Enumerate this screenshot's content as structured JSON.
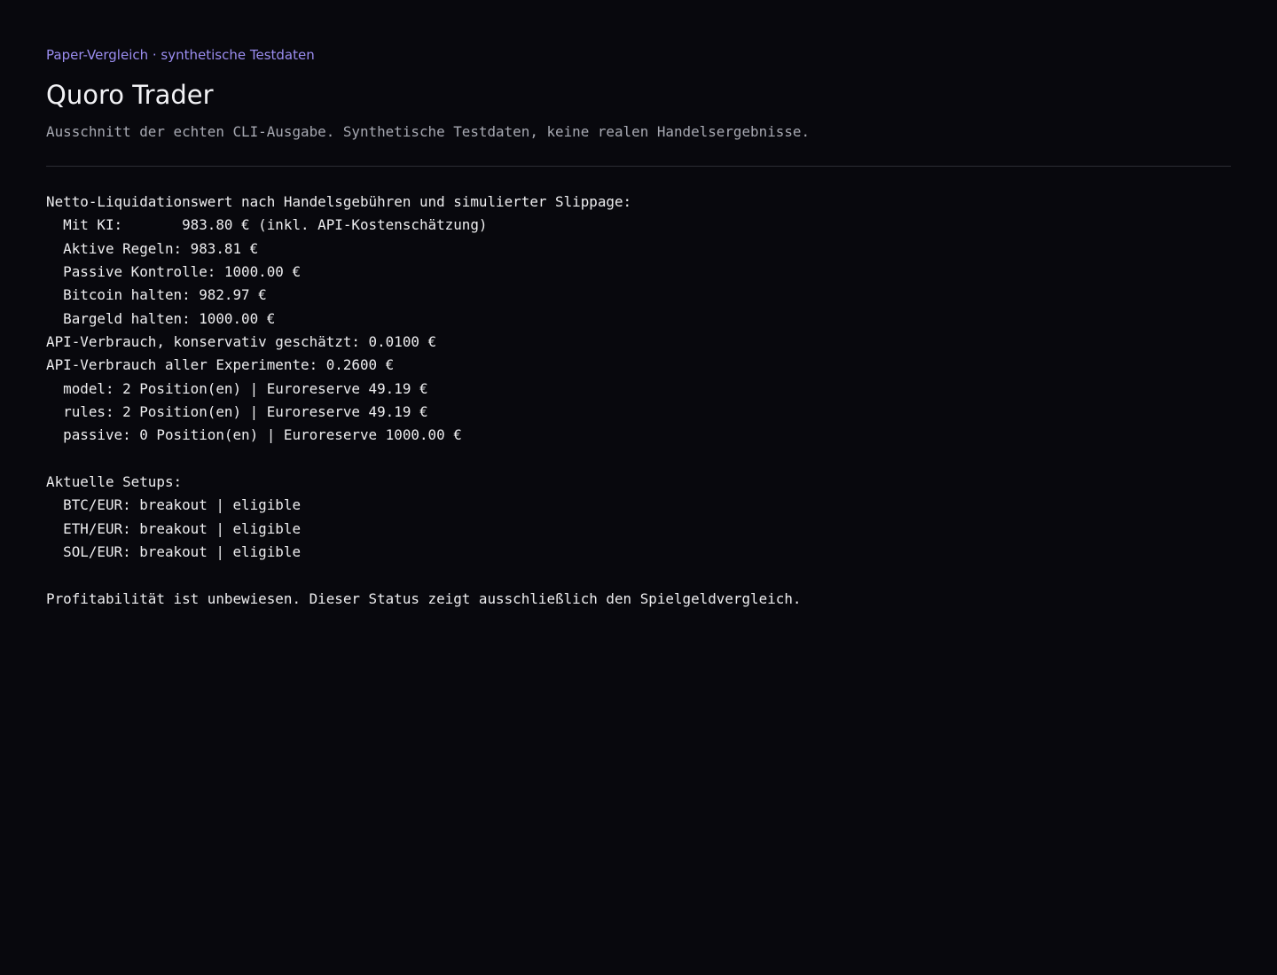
{
  "header": {
    "eyebrow": "Paper-Vergleich · synthetische Testdaten",
    "title": "Quoro Trader",
    "subtitle": "Ausschnitt der echten CLI-Ausgabe. Synthetische Testdaten, keine realen Handelsergebnisse."
  },
  "output": {
    "lines": [
      "Netto-Liquidationswert nach Handelsgebühren und simulierter Slippage:",
      "  Mit KI:       983.80 € (inkl. API-Kostenschätzung)",
      "  Aktive Regeln: 983.81 €",
      "  Passive Kontrolle: 1000.00 €",
      "  Bitcoin halten: 982.97 €",
      "  Bargeld halten: 1000.00 €",
      "API-Verbrauch, konservativ geschätzt: 0.0100 €",
      "API-Verbrauch aller Experimente: 0.2600 €",
      "  model: 2 Position(en) | Euroreserve 49.19 €",
      "  rules: 2 Position(en) | Euroreserve 49.19 €",
      "  passive: 0 Position(en) | Euroreserve 1000.00 €",
      "",
      "Aktuelle Setups:",
      "  BTC/EUR: breakout | eligible",
      "  ETH/EUR: breakout | eligible",
      "  SOL/EUR: breakout | eligible",
      "",
      "Profitabilität ist unbewiesen. Dieser Status zeigt ausschließlich den Spielgeldvergleich."
    ]
  },
  "colors": {
    "background": "#08080d",
    "accent": "#9b8df0",
    "text": "#eeeef0",
    "muted": "#a7a9b2",
    "divider": "#2b2c34"
  }
}
